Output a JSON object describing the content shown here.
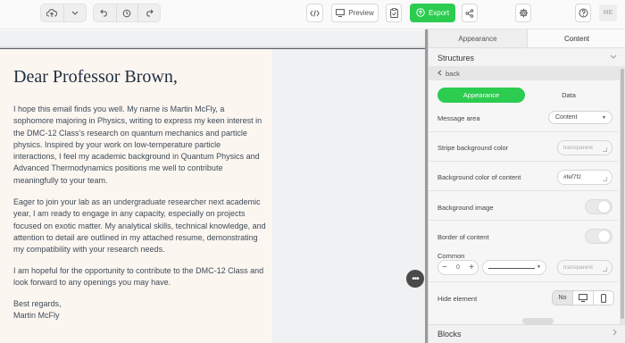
{
  "toolbar": {
    "upload_icon": "cloud-upload-icon",
    "dropdown_icon": "chevron-down-icon",
    "undo_icon": "undo-icon",
    "history_icon": "history-icon",
    "redo_icon": "redo-icon",
    "code_icon": "code-icon",
    "preview_label": "Preview",
    "preview_icon": "monitor-icon",
    "checklist_icon": "clipboard-check-icon",
    "export_label": "Export",
    "export_icon": "upload-icon",
    "share_icon": "share-icon",
    "settings_icon": "gear-icon",
    "help_icon": "help-icon",
    "avatar_initials": "ME",
    "accent_color": "#2bcc4f"
  },
  "email": {
    "greeting": "Dear Professor Brown,",
    "paragraph1": "I hope this email finds you well. My name is Martin McFly, a sophomore majoring in Physics, writing to express my keen interest in the DMC-12 Class's research on quantum mechanics and particle physics. Inspired by your work on low-temperature particle interactions, I feel my academic background in Quantum Physics and Advanced Thermodynamics positions me well to contribute meaningfully to your team.",
    "paragraph2": "Eager to join your lab as an undergraduate researcher next academic year, I am ready to engage in any capacity, especially on projects focused on exotic matter. My analytical skills, technical knowledge, and attention to detail are outlined in my attached resume, demonstrating my compatibility with your research needs.",
    "paragraph3": "I am hopeful for the opportunity to contribute to the DMC-12 Class and look forward to any openings you may have.",
    "signoff": "Best regards,",
    "signature": "Martin McFly",
    "content_bg": "#fef7f2"
  },
  "panel": {
    "tabs": [
      "Appearance",
      "Content"
    ],
    "active_tab": "Content",
    "structures_label": "Structures",
    "back_label": "back",
    "segment": {
      "appearance": "Appearance",
      "data": "Data"
    },
    "message_area": {
      "label": "Message area",
      "value": "Content"
    },
    "stripe_bg": {
      "label": "Stripe background color",
      "placeholder": "transparent"
    },
    "content_bg": {
      "label": "Background color of content",
      "value": "#fef7f2"
    },
    "bg_image": {
      "label": "Background image"
    },
    "border": {
      "label": "Border of content",
      "common_label": "Common",
      "width": "0",
      "color_placeholder": "transparent"
    },
    "hide_element": {
      "label": "Hide element",
      "no_label": "No",
      "desktop_icon": "desktop-icon",
      "mobile_icon": "mobile-icon"
    },
    "blocks_label": "Blocks"
  }
}
